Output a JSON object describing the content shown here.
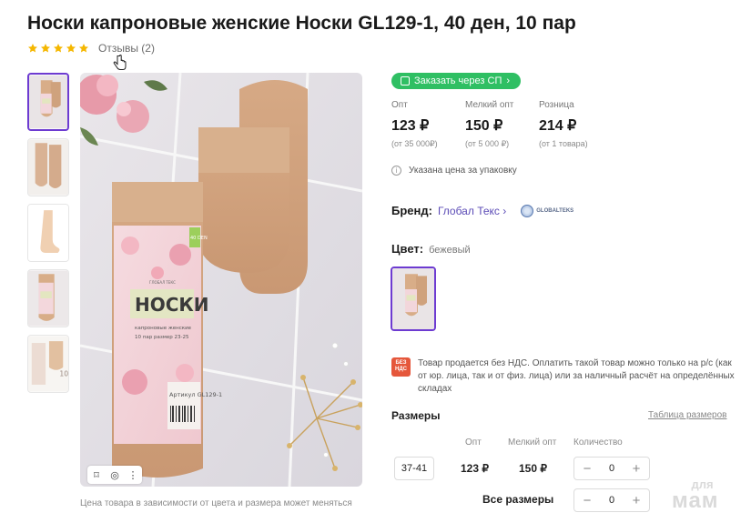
{
  "product": {
    "title": "Носки капроновые женские Носки GL129-1, 40 ден, 10 пар",
    "rating_stars": 5,
    "reviews_label": "Отзывы (2)"
  },
  "gallery": {
    "thumbnail_count": 5,
    "caption": "Цена товара в зависимости от цвета и размера может меняться",
    "package": {
      "brand_small": "ГЛОБАЛ ТЕКС",
      "name": "НОСКИ",
      "line1": "капроновые женские",
      "line2": "10 пар   размер 23-25",
      "den": "40 DEN",
      "article": "Артикул GL129-1"
    }
  },
  "order": {
    "sp_button_label": "Заказать через СП"
  },
  "prices": [
    {
      "label": "Опт",
      "value": "123 ₽",
      "note": "(от 35 000₽)"
    },
    {
      "label": "Мелкий опт",
      "value": "150 ₽",
      "note": "(от 5 000 ₽)"
    },
    {
      "label": "Розница",
      "value": "214 ₽",
      "note": "(от 1 товара)"
    }
  ],
  "price_info": "Указана цена за упаковку",
  "brand": {
    "label": "Бренд:",
    "name": "Глобал Текс",
    "logo_text": "GLOBALTEKS"
  },
  "color": {
    "label": "Цвет:",
    "value": "бежевый"
  },
  "vat": {
    "badge_top": "БЕЗ",
    "badge_bottom": "НДС",
    "text": "Товар продается без НДС. Оплатить такой товар можно только на р/с (как от юр. лица, так и от физ. лица) или за наличный расчёт на определённых складах"
  },
  "sizes": {
    "title": "Размеры",
    "table_link": "Таблица размеров",
    "columns": {
      "wholesale": "Опт",
      "small_wholesale": "Мелкий опт",
      "quantity": "Количество"
    },
    "rows": [
      {
        "size": "37-41",
        "wholesale": "123 ₽",
        "small_wholesale": "150 ₽",
        "quantity": "0"
      }
    ],
    "all_sizes_label": "Все размеры",
    "all_sizes_quantity": "0"
  },
  "watermark": {
    "line1": "для",
    "line2": "мам"
  },
  "colors": {
    "accent_purple": "#6d3bd1",
    "sp_green": "#2fbf63",
    "vat_red": "#e5573b",
    "star_gold": "#f5b700",
    "brand_link": "#5b4bb6"
  },
  "icons": [
    "star-icon",
    "hand-cursor-icon",
    "bookmark-icon",
    "lens-icon",
    "more-icon",
    "shopping-bag-icon",
    "chevron-right-icon",
    "info-icon",
    "globe-logo-icon"
  ]
}
